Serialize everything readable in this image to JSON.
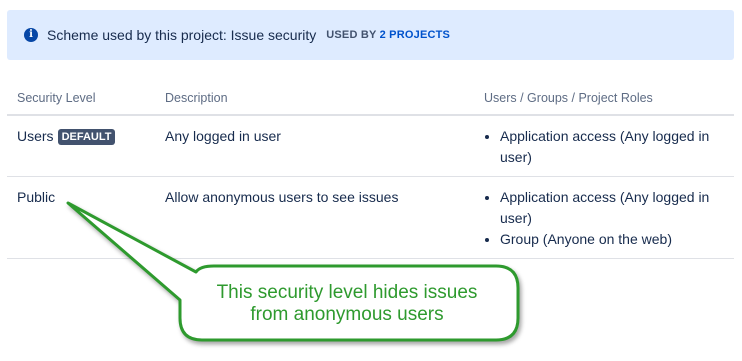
{
  "banner": {
    "icon": "info-icon",
    "text": "Scheme used by this project: Issue security",
    "used_by_prefix": "USED BY",
    "used_by_count": "2 PROJECTS"
  },
  "table": {
    "headers": {
      "level": "Security Level",
      "description": "Description",
      "roles": "Users / Groups / Project Roles"
    },
    "rows": [
      {
        "level": "Users",
        "badge": "DEFAULT",
        "description": "Any logged in user",
        "roles": [
          "Application access (Any logged in user)"
        ]
      },
      {
        "level": "Public",
        "badge": "",
        "description": "Allow anonymous users to see issues",
        "roles": [
          "Application access (Any logged in user)",
          "Group (Anyone on the web)"
        ]
      }
    ]
  },
  "callout": {
    "line1": "This security level hides issues",
    "line2": "from anonymous users",
    "color": "#2e9a2e"
  }
}
